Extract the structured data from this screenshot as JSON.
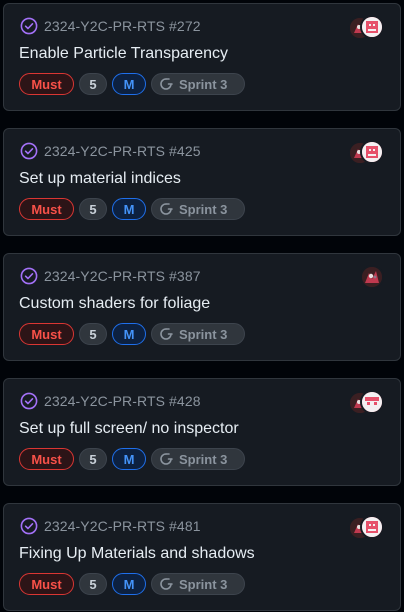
{
  "cards": [
    {
      "ref": "2324-Y2C-PR-RTS #272",
      "title": "Enable Particle Transparency",
      "priority": "Must",
      "estimate": "5",
      "size": "M",
      "sprint": "Sprint 3",
      "avatars": 2
    },
    {
      "ref": "2324-Y2C-PR-RTS #425",
      "title": "Set up material indices",
      "priority": "Must",
      "estimate": "5",
      "size": "M",
      "sprint": "Sprint 3",
      "avatars": 2
    },
    {
      "ref": "2324-Y2C-PR-RTS #387",
      "title": "Custom shaders for foliage",
      "priority": "Must",
      "estimate": "5",
      "size": "M",
      "sprint": "Sprint 3",
      "avatars": 1
    },
    {
      "ref": "2324-Y2C-PR-RTS #428",
      "title": "Set up full screen/ no inspector",
      "priority": "Must",
      "estimate": "5",
      "size": "M",
      "sprint": "Sprint 3",
      "avatars": 2
    },
    {
      "ref": "2324-Y2C-PR-RTS #481",
      "title": "Fixing Up Materials and shadows",
      "priority": "Must",
      "estimate": "5",
      "size": "M",
      "sprint": "Sprint 3",
      "avatars": 2
    }
  ],
  "icons": {
    "status": "issue-closed-check-icon",
    "sprint": "iteration-icon",
    "avatar": "user-avatar"
  },
  "colors": {
    "status_purple": "#a371f7",
    "must_red": "#f85149",
    "size_blue": "#4493f8",
    "card_bg": "#161b22",
    "page_bg": "#010409"
  }
}
